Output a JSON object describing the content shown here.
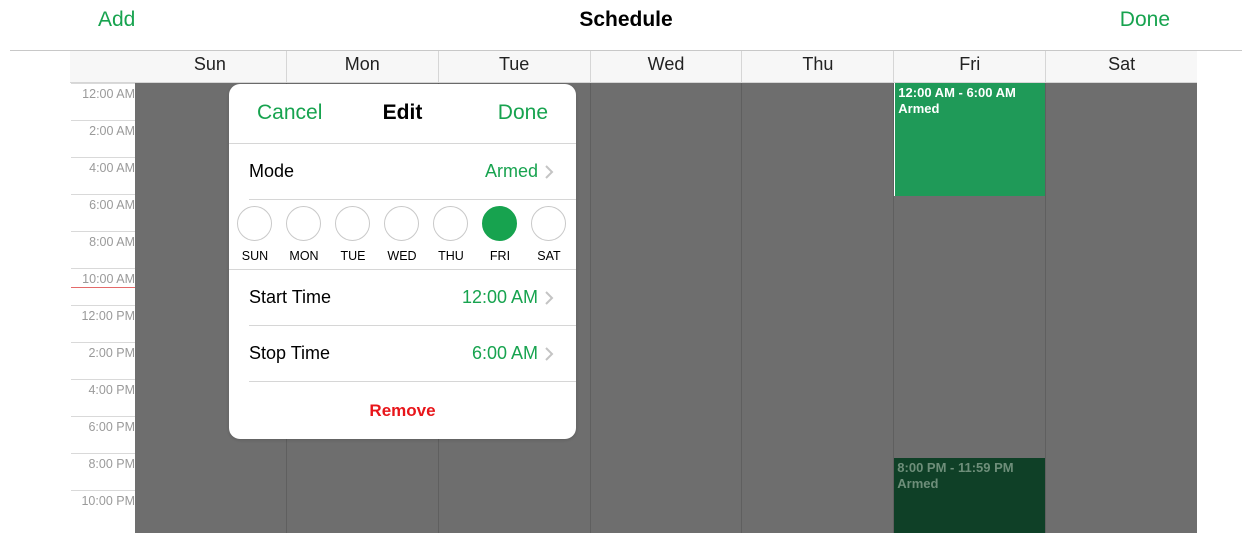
{
  "nav": {
    "add_label": "Add",
    "title": "Schedule",
    "done_label": "Done"
  },
  "days": [
    "Sun",
    "Mon",
    "Tue",
    "Wed",
    "Thu",
    "Fri",
    "Sat"
  ],
  "time_labels": [
    "12:00 AM",
    "2:00 AM",
    "4:00 AM",
    "6:00 AM",
    "8:00 AM",
    "10:00 AM",
    "12:00 PM",
    "2:00 PM",
    "4:00 PM",
    "6:00 PM",
    "8:00 PM",
    "10:00 PM"
  ],
  "events": [
    {
      "day": "Fri",
      "time": "12:00 AM - 6:00 AM",
      "mode": "Armed"
    },
    {
      "day": "Fri",
      "time": "8:00 PM - 11:59 PM",
      "mode": "Armed"
    }
  ],
  "editor": {
    "cancel_label": "Cancel",
    "title": "Edit",
    "done_label": "Done",
    "mode_label": "Mode",
    "mode_value": "Armed",
    "day_options": [
      "SUN",
      "MON",
      "TUE",
      "WED",
      "THU",
      "FRI",
      "SAT"
    ],
    "selected_day": "FRI",
    "start_label": "Start Time",
    "start_value": "12:00 AM",
    "stop_label": "Stop Time",
    "stop_value": "6:00 AM",
    "remove_label": "Remove"
  },
  "colors": {
    "accent": "#17a34f",
    "danger": "#e8151a",
    "grid": "#6e6e6e",
    "event": "#1f9a58",
    "event_dim": "#0f4027"
  }
}
